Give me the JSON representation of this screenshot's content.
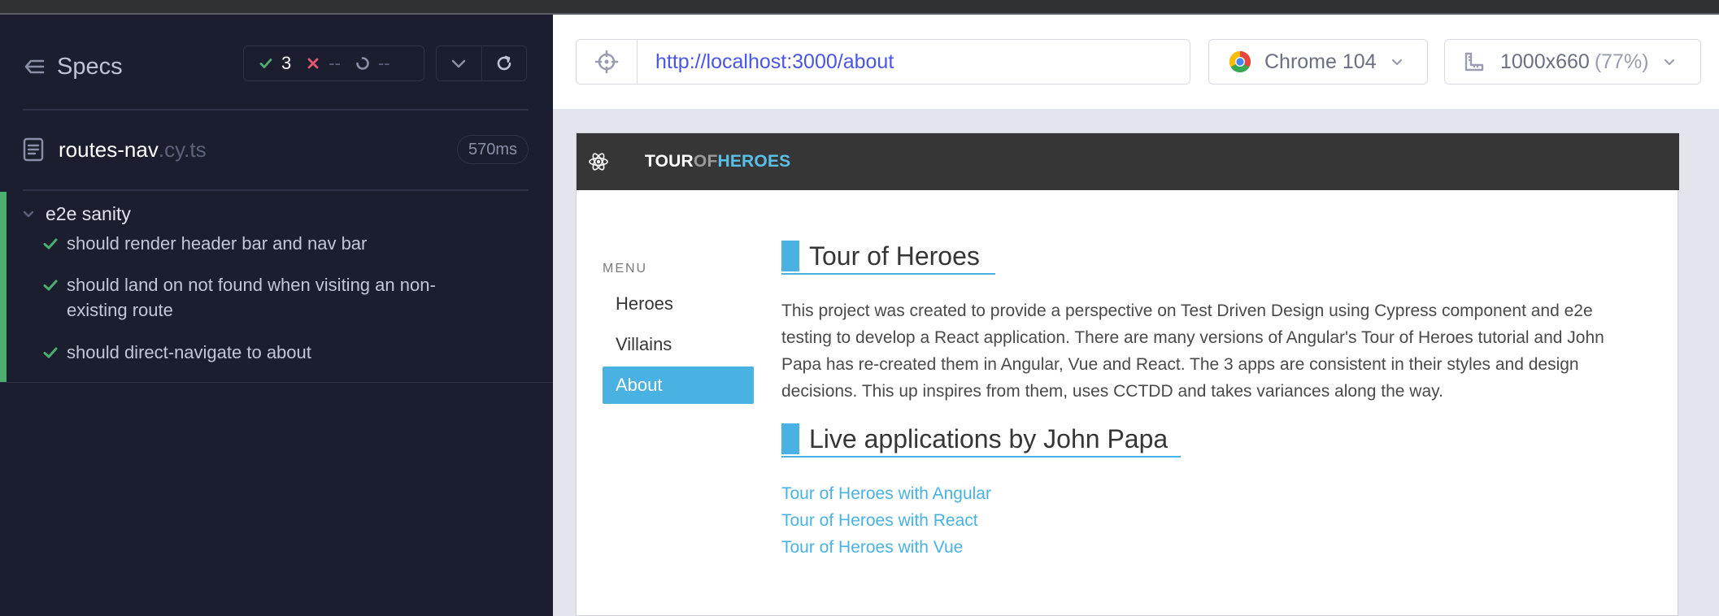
{
  "reporter": {
    "specs_label": "Specs",
    "stats": {
      "passed": "3",
      "failed": "--",
      "pending": "--"
    },
    "spec_file": {
      "name": "routes-nav",
      "ext": ".cy.ts",
      "duration": "570ms"
    },
    "suite": {
      "title": "e2e sanity",
      "tests": [
        {
          "title": "should render header bar and nav bar",
          "state": "passed"
        },
        {
          "title": "should land on not found when visiting an non-existing route",
          "state": "passed"
        },
        {
          "title": "should direct-navigate to about",
          "state": "passed"
        }
      ]
    }
  },
  "toolbar": {
    "url": "http://localhost:3000/about",
    "browser": "Chrome 104",
    "viewport": "1000x660",
    "scale": "(77%)"
  },
  "app": {
    "brand": {
      "part1": "TOUR",
      "part2": "OF",
      "part3": "HEROES"
    },
    "menu": {
      "label": "MENU",
      "items": [
        "Heroes",
        "Villains",
        "About"
      ],
      "active": "About"
    },
    "about": {
      "heading1": "Tour of Heroes",
      "paragraph": "This project was created to provide a perspective on Test Driven Design using Cypress component and e2e testing to develop a React application. There are many versions of Angular's Tour of Heroes tutorial and John Papa has re-created them in Angular, Vue and React. The 3 apps are consistent in their styles and design decisions. This up inspires from them, uses CCTDD and takes variances along the way.",
      "heading2": "Live applications by John Papa",
      "links": [
        "Tour of Heroes with Angular",
        "Tour of Heroes with React",
        "Tour of Heroes with Vue"
      ]
    }
  },
  "colors": {
    "reporter_bg": "#1b1e2e",
    "pass": "#4caf70",
    "fail": "#e45770",
    "accent": "#4ab2e3",
    "url": "#4956e3"
  }
}
